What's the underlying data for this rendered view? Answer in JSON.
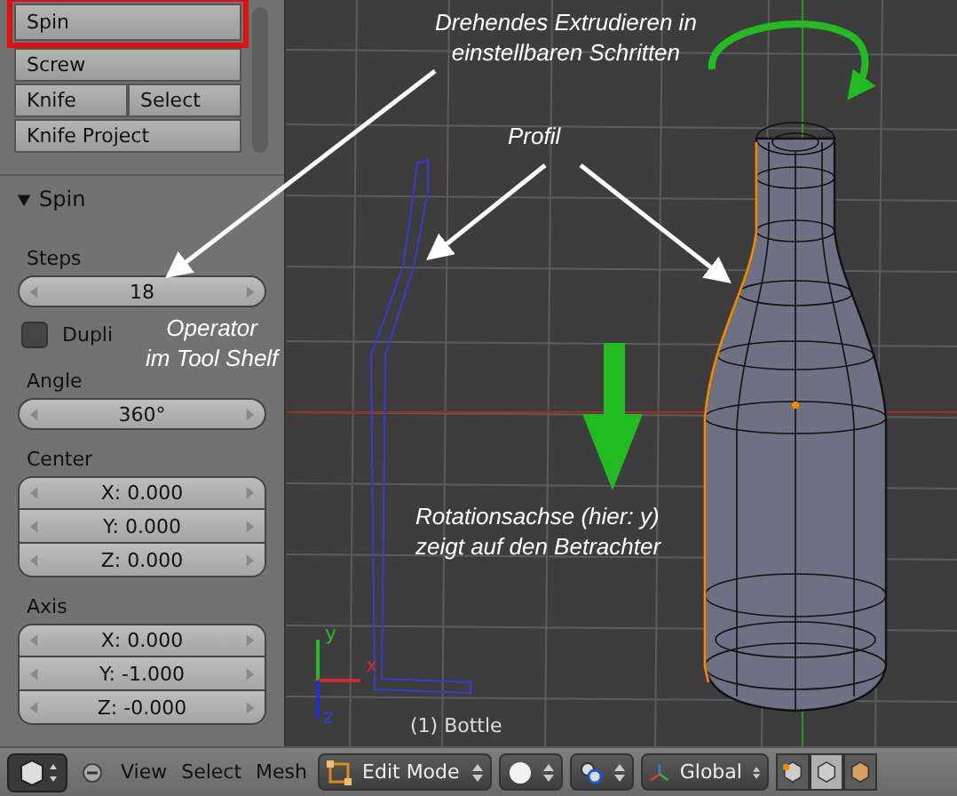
{
  "tool_shelf": {
    "rows": [
      {
        "buttons": [
          {
            "label": "Spin",
            "highlighted": true
          }
        ]
      },
      {
        "buttons": [
          {
            "label": "Screw",
            "highlighted": false
          }
        ]
      },
      {
        "buttons": [
          {
            "label": "Knife",
            "highlighted": false
          },
          {
            "label": "Select",
            "highlighted": false
          }
        ]
      },
      {
        "buttons": [
          {
            "label": "Knife Project",
            "highlighted": false
          }
        ]
      }
    ]
  },
  "operator": {
    "title": "Spin",
    "expanded": true,
    "steps": {
      "label": "Steps",
      "value": "18"
    },
    "dupli": {
      "label": "Dupli",
      "checked": false
    },
    "angle": {
      "label": "Angle",
      "value": "360°"
    },
    "center": {
      "label": "Center",
      "values": [
        "X: 0.000",
        "Y: 0.000",
        "Z: 0.000"
      ]
    },
    "axis": {
      "label": "Axis",
      "values": [
        "X: 0.000",
        "Y: -1.000",
        "Z: -0.000"
      ]
    }
  },
  "viewport": {
    "object_label": "(1) Bottle",
    "axis_labels": [
      "y",
      "x",
      "z"
    ]
  },
  "annotations": [
    {
      "lines": [
        "Drehendes Extrudieren in",
        "einstellbaren Schritten"
      ]
    },
    {
      "lines": [
        "Profil"
      ]
    },
    {
      "lines": [
        "Operator",
        "im Tool Shelf"
      ]
    },
    {
      "lines": [
        "Rotationsachse (hier: y)",
        "zeigt auf den Betrachter"
      ]
    }
  ],
  "header": {
    "menus": [
      "View",
      "Select",
      "Mesh"
    ],
    "mode": "Edit Mode",
    "orientation": "Global",
    "select_modes": [
      {
        "selected": false
      },
      {
        "selected": true
      },
      {
        "selected": false
      }
    ]
  }
}
